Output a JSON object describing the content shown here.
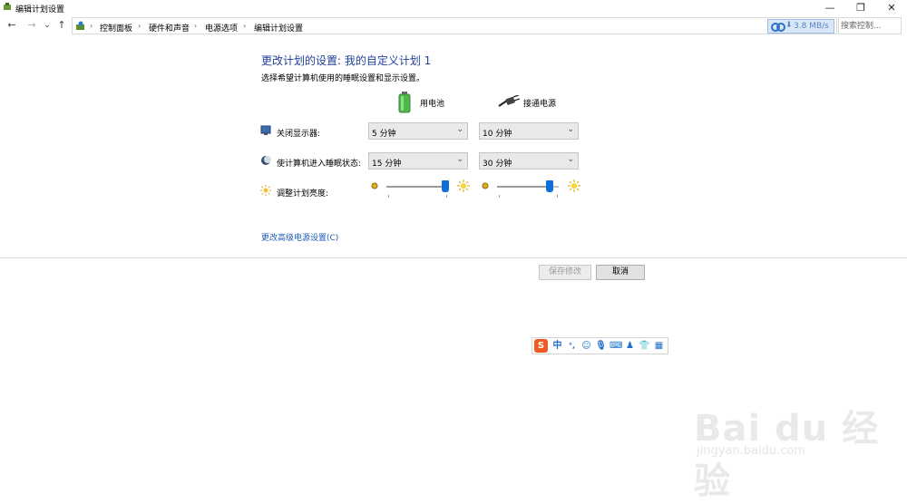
{
  "window": {
    "title": "编辑计划设置",
    "minimize_glyph": "—",
    "restore_glyph": "❐",
    "close_glyph": "✕"
  },
  "nav": {
    "back_glyph": "←",
    "forward_glyph": "→",
    "recent_glyph": "⌄",
    "up_glyph": "↑",
    "breadcrumbs": [
      "控制面板",
      "硬件和声音",
      "电源选项",
      "编辑计划设置"
    ],
    "separator": "›",
    "net_speed": "3.8 MB/s",
    "search_placeholder": "搜索控制..."
  },
  "main": {
    "heading": "更改计划的设置: 我的自定义计划 1",
    "subheading": "选择希望计算机使用的睡眠设置和显示设置。",
    "col_battery": "用电池",
    "col_plugged": "接通电源",
    "rows": {
      "display_label": "关闭显示器:",
      "display_battery": "5 分钟",
      "display_plugged": "10 分钟",
      "sleep_label": "使计算机进入睡眠状态:",
      "sleep_battery": "15 分钟",
      "sleep_plugged": "30 分钟",
      "brightness_label": "调整计划亮度:",
      "brightness_battery_pct": 95,
      "brightness_plugged_pct": 85
    },
    "advanced_link": "更改高级电源设置(C)",
    "save_label": "保存修改",
    "cancel_label": "取消"
  },
  "ime_bar": {
    "logo": "S",
    "mode": "中",
    "punct": "°,"
  },
  "watermark": {
    "brand": "Bai du 经验",
    "url": "jingyan.baidu.com"
  },
  "colors": {
    "heading_blue": "#1e3f9c",
    "link_blue": "#1e5bb8",
    "slider_thumb": "#0e6fd6",
    "ime_orange": "#f05a22"
  }
}
